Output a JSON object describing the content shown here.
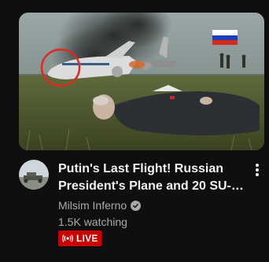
{
  "video": {
    "title": "Putin's Last Flight! Russian President's Plane and 20 SU-27...",
    "channel": "Milsim Inferno",
    "views": "1.5K watching",
    "live_badge": "LIVE",
    "verified": true
  },
  "icons": {
    "verified": "check-circle-icon",
    "live": "broadcast-icon",
    "menu": "more-vert-icon"
  },
  "colors": {
    "background": "#0f0f0f",
    "title": "#f1f1f1",
    "meta": "#aaaaaa",
    "live_badge": "#cc0000"
  }
}
